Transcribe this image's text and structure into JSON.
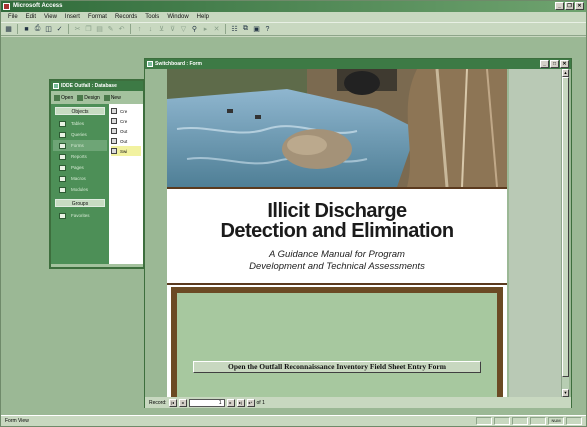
{
  "app": {
    "title": "Microsoft Access"
  },
  "menubar": [
    "File",
    "Edit",
    "View",
    "Insert",
    "Format",
    "Records",
    "Tools",
    "Window",
    "Help"
  ],
  "toolbar": {
    "icons": [
      "view-icon",
      "save-icon",
      "print-icon",
      "preview-icon",
      "spelling-icon",
      "cut-icon",
      "copy-icon",
      "paste-icon",
      "format-painter-icon",
      "undo-icon",
      "sort-ascending-icon",
      "sort-descending-icon",
      "filter-by-selection-icon",
      "filter-by-form-icon",
      "apply-filter-icon",
      "find-icon",
      "new-record-icon",
      "delete-record-icon",
      "properties-icon",
      "database-window-icon",
      "new-object-icon",
      "help-icon"
    ]
  },
  "db_window": {
    "title": "IDDE Outfall : Database",
    "tools": {
      "open": "Open",
      "design": "Design",
      "new": "New"
    },
    "objects_header": "Objects",
    "objects": [
      "Tables",
      "Queries",
      "Forms",
      "Reports",
      "Pages",
      "Macros",
      "Modules"
    ],
    "selected_object": "Forms",
    "groups_header": "Groups",
    "groups": [
      "Favorites"
    ],
    "list_items": [
      "Cre",
      "Cre",
      "Out",
      "Out",
      "Swi"
    ]
  },
  "switchboard": {
    "title": "Switchboard : Form",
    "main_title_line1": "Illicit Discharge",
    "main_title_line2": "Detection and Elimination",
    "subtitle_line1": "A Guidance Manual for Program",
    "subtitle_line2": "Development and Technical Assessments",
    "entry_button_label": "Open the Outfall Reconnaissance Inventory Field Sheet Entry Form"
  },
  "record_nav": {
    "label": "Record:",
    "current": "1",
    "of_label": "of 1"
  },
  "statusbar": {
    "text": "Form View",
    "cells": [
      "",
      "",
      "",
      "",
      "NUM",
      ""
    ]
  },
  "colors": {
    "accent": "#3d7a45",
    "brown_frame": "#6b4a24",
    "panel_green": "#a7c89f"
  }
}
